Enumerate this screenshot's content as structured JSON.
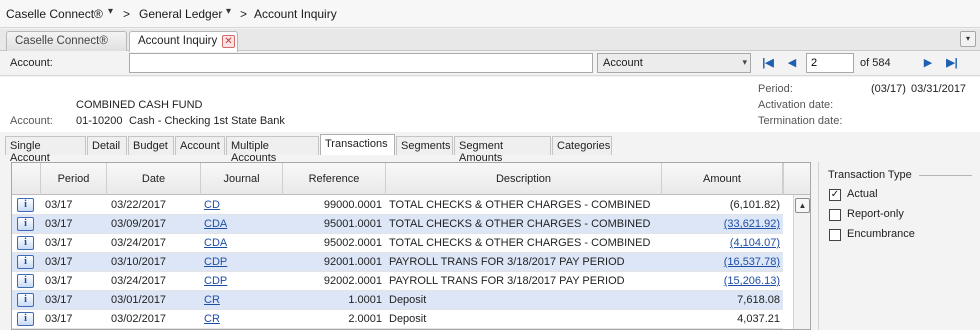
{
  "breadcrumb": {
    "app": "Caselle Connect®",
    "module": "General Ledger",
    "page": "Account Inquiry",
    "separator": ">",
    "dropdown_glyph": "▾"
  },
  "tabs": [
    {
      "label": "Caselle Connect®",
      "active": false
    },
    {
      "label": "Account Inquiry",
      "active": true,
      "close_glyph": "✕"
    }
  ],
  "tab_menu_glyph": "▾",
  "account_bar": {
    "label": "Account:",
    "value": "",
    "lookup_field": "Account",
    "dropdown_glyph": "▾",
    "page_value": "2",
    "of_label": "of 584",
    "nav": {
      "first": "|◀",
      "prev": "◀",
      "next": "▶",
      "last": "▶|"
    }
  },
  "account_info": {
    "name": "COMBINED CASH FUND",
    "label": "Account:",
    "number": "01-10200",
    "description": "Cash - Checking 1st State Bank",
    "period_label": "Period:",
    "period_code": "(03/17)",
    "period_date": "03/31/2017",
    "activation_label": "Activation date:",
    "activation_value": "",
    "termination_label": "Termination date:",
    "termination_value": ""
  },
  "subtabs": [
    {
      "label": "Single Account",
      "active": false
    },
    {
      "label": "Detail",
      "active": false
    },
    {
      "label": "Budget",
      "active": false
    },
    {
      "label": "Account",
      "active": false
    },
    {
      "label": "Multiple Accounts",
      "active": false
    },
    {
      "label": "Transactions",
      "active": true
    },
    {
      "label": "Segments",
      "active": false
    },
    {
      "label": "Segment Amounts",
      "active": false
    },
    {
      "label": "Categories",
      "active": false
    }
  ],
  "grid": {
    "columns": [
      "",
      "Period",
      "Date",
      "Journal",
      "Reference",
      "Description",
      "Amount"
    ],
    "info_glyph": "i",
    "rows": [
      {
        "period": "03/17",
        "date": "03/22/2017",
        "journal": "CD",
        "reference": "99000.0001",
        "description": "TOTAL CHECKS & OTHER CHARGES - COMBINED",
        "amount": "(6,101.82)",
        "amount_link": false
      },
      {
        "period": "03/17",
        "date": "03/09/2017",
        "journal": "CDA",
        "reference": "95001.0001",
        "description": "TOTAL CHECKS & OTHER CHARGES - COMBINED",
        "amount": "(33,621.92)",
        "amount_link": true
      },
      {
        "period": "03/17",
        "date": "03/24/2017",
        "journal": "CDA",
        "reference": "95002.0001",
        "description": "TOTAL CHECKS & OTHER CHARGES - COMBINED",
        "amount": "(4,104.07)",
        "amount_link": true
      },
      {
        "period": "03/17",
        "date": "03/10/2017",
        "journal": "CDP",
        "reference": "92001.0001",
        "description": "PAYROLL TRANS FOR 3/18/2017 PAY PERIOD",
        "amount": "(16,537.78)",
        "amount_link": true
      },
      {
        "period": "03/17",
        "date": "03/24/2017",
        "journal": "CDP",
        "reference": "92002.0001",
        "description": "PAYROLL TRANS FOR 3/18/2017 PAY PERIOD",
        "amount": "(15,206.13)",
        "amount_link": true
      },
      {
        "period": "03/17",
        "date": "03/01/2017",
        "journal": "CR",
        "reference": "1.0001",
        "description": "Deposit",
        "amount": "7,618.08",
        "amount_link": false
      },
      {
        "period": "03/17",
        "date": "03/02/2017",
        "journal": "CR",
        "reference": "2.0001",
        "description": "Deposit",
        "amount": "4,037.21",
        "amount_link": false
      }
    ]
  },
  "scroll_up_glyph": "▲",
  "transaction_type": {
    "title": "Transaction Type",
    "options": [
      {
        "label": "Actual",
        "checked": true
      },
      {
        "label": "Report-only",
        "checked": false
      },
      {
        "label": "Encumbrance",
        "checked": false
      }
    ],
    "check_glyph": "✓"
  }
}
